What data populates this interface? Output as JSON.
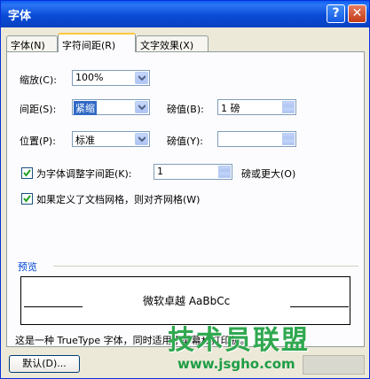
{
  "window": {
    "title": "字体",
    "help_glyph": "?",
    "close_glyph": "✕"
  },
  "tabs": [
    {
      "label": "字体(N)"
    },
    {
      "label": "字符间距(R)"
    },
    {
      "label": "文字效果(X)"
    }
  ],
  "form": {
    "scale": {
      "label": "缩放(C):",
      "value": "100%"
    },
    "spacing": {
      "label": "间距(S):",
      "value": "紧缩",
      "pt_label": "磅值(B):",
      "pt_value": "1 磅"
    },
    "position": {
      "label": "位置(P):",
      "value": "标准",
      "pt_label": "磅值(Y):",
      "pt_value": ""
    },
    "kerning": {
      "label": "为字体调整字间距(K):",
      "checked": true,
      "value": "1",
      "suffix": "磅或更大(O)"
    },
    "grid": {
      "label": "如果定义了文档网格，则对齐网格(W)",
      "checked": true
    }
  },
  "preview": {
    "label": "预览",
    "text": "微软卓越 AaBbCc"
  },
  "note": "这是一种 TrueType 字体，同时适用于屏幕和打印机。",
  "buttons": {
    "default": "默认(D)..."
  },
  "watermark": {
    "text": "技术员联盟",
    "url": "www.jsgho.com"
  }
}
